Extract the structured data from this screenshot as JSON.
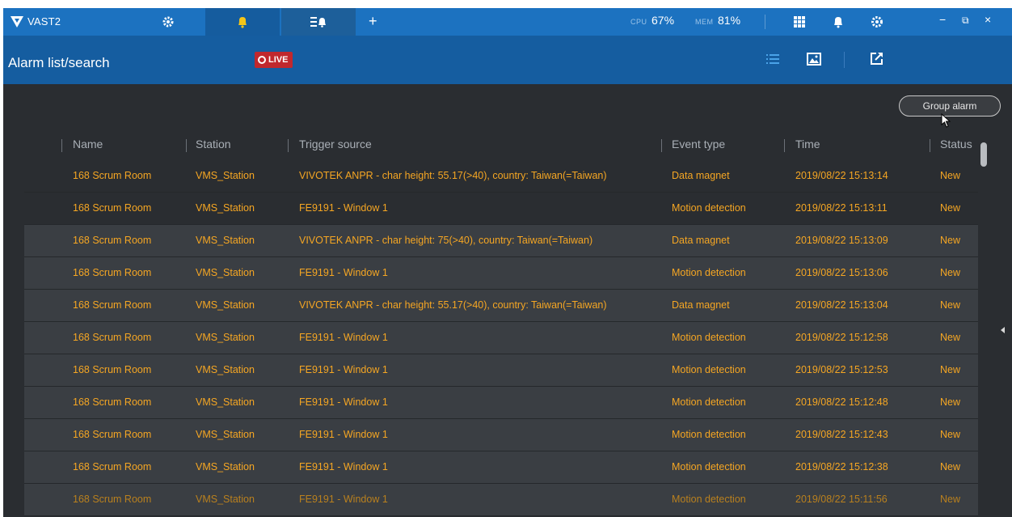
{
  "app": {
    "title": "VAST2"
  },
  "topbar": {
    "cpu_label": "CPU",
    "cpu_value": "67%",
    "mem_label": "MEM",
    "mem_value": "81%",
    "add_tab_label": "+",
    "window_minimize": "−",
    "window_restore": "⧉",
    "window_close": "×",
    "tabs": [
      {
        "icon": "gear-icon"
      },
      {
        "icon": "bell-icon",
        "color": "#f5c518"
      },
      {
        "icon": "alarm-list-icon"
      }
    ],
    "right_icons": [
      "apps-grid-icon",
      "notification-bell-icon",
      "settings-gear-icon"
    ]
  },
  "subheader": {
    "title": "Alarm list/search",
    "live_label": "LIVE",
    "view_icons": [
      "list-view-icon",
      "image-view-icon",
      "export-icon"
    ]
  },
  "group_alarm_label": "Group alarm",
  "table": {
    "columns": [
      "Name",
      "Station",
      "Trigger source",
      "Event type",
      "Time",
      "Status"
    ],
    "rows": [
      [
        "168 Scrum Room",
        "VMS_Station",
        "VIVOTEK ANPR - char height: 55.17(>40), country: Taiwan(=Taiwan)",
        "Data magnet",
        "2019/08/22 15:13:14",
        "New"
      ],
      [
        "168 Scrum Room",
        "VMS_Station",
        "FE9191 - Window 1",
        "Motion detection",
        "2019/08/22 15:13:11",
        "New"
      ],
      [
        "168 Scrum Room",
        "VMS_Station",
        "VIVOTEK ANPR - char height: 75(>40), country: Taiwan(=Taiwan)",
        "Data magnet",
        "2019/08/22 15:13:09",
        "New"
      ],
      [
        "168 Scrum Room",
        "VMS_Station",
        "FE9191 - Window 1",
        "Motion detection",
        "2019/08/22 15:13:06",
        "New"
      ],
      [
        "168 Scrum Room",
        "VMS_Station",
        "VIVOTEK ANPR - char height: 55.17(>40), country: Taiwan(=Taiwan)",
        "Data magnet",
        "2019/08/22 15:13:04",
        "New"
      ],
      [
        "168 Scrum Room",
        "VMS_Station",
        "FE9191 - Window 1",
        "Motion detection",
        "2019/08/22 15:12:58",
        "New"
      ],
      [
        "168 Scrum Room",
        "VMS_Station",
        "FE9191 - Window 1",
        "Motion detection",
        "2019/08/22 15:12:53",
        "New"
      ],
      [
        "168 Scrum Room",
        "VMS_Station",
        "FE9191 - Window 1",
        "Motion detection",
        "2019/08/22 15:12:48",
        "New"
      ],
      [
        "168 Scrum Room",
        "VMS_Station",
        "FE9191 - Window 1",
        "Motion detection",
        "2019/08/22 15:12:43",
        "New"
      ],
      [
        "168 Scrum Room",
        "VMS_Station",
        "FE9191 - Window 1",
        "Motion detection",
        "2019/08/22 15:12:38",
        "New"
      ],
      [
        "168 Scrum Room",
        "VMS_Station",
        "FE9191 - Window 1",
        "Motion detection",
        "2019/08/22 15:11:56",
        "New"
      ]
    ]
  },
  "colors": {
    "topbar": "#1c72c0",
    "subheader": "#155da0",
    "content_bg": "#2a2d31",
    "row_text": "#f5a623",
    "live_badge": "#c0282e"
  }
}
